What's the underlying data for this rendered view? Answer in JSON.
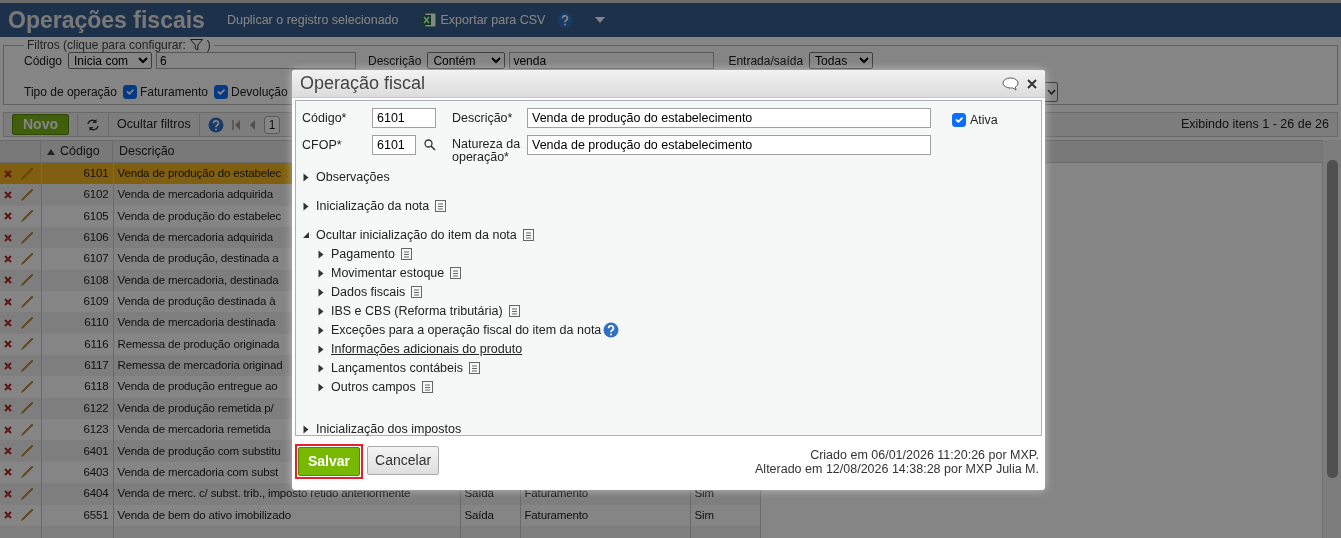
{
  "page": {
    "title": "Operações fiscais",
    "actions": [
      {
        "label": "Duplicar o registro selecionado",
        "kind": "plain"
      },
      {
        "label": "Exportar para CSV",
        "kind": "csv"
      }
    ]
  },
  "filters": {
    "legend_start": "Filtros (clique para configurar:",
    "legend_end": ")",
    "fields": [
      {
        "label": "Código",
        "operator": "Inicia com",
        "value": "6"
      },
      {
        "label": "Descrição",
        "operator": "Contém",
        "value": "venda"
      },
      {
        "label": "Entrada/saída",
        "operator": "Todas"
      }
    ],
    "operation_types": {
      "label": "Tipo de operação",
      "options": [
        {
          "label": "Faturamento",
          "checked": true
        },
        {
          "label": "Devolução",
          "checked": true
        }
      ]
    }
  },
  "toolbar": {
    "new_button": "Novo",
    "hide_filters": "Ocultar filtros",
    "page": "1",
    "summary": "Exibindo itens 1 - 26 de 26"
  },
  "table": {
    "columns": [
      {
        "label": "Código",
        "sorted": true
      },
      {
        "label": "Descrição",
        "sorted": false
      }
    ],
    "rows": [
      {
        "code": "6101",
        "description": "Venda de produção do estabelec",
        "selected": true
      },
      {
        "code": "6102",
        "description": "Venda de mercadoria adquirida",
        "selected": false
      },
      {
        "code": "6105",
        "description": "Venda de produção do estabelec",
        "selected": false
      },
      {
        "code": "6106",
        "description": "Venda de mercadoria adquirida",
        "selected": false
      },
      {
        "code": "6107",
        "description": "Venda de produção, destinada a",
        "selected": false
      },
      {
        "code": "6108",
        "description": "Venda de mercadoria, destinada",
        "selected": false
      },
      {
        "code": "6109",
        "description": "Venda de produção destinada à",
        "selected": false
      },
      {
        "code": "6110",
        "description": "Venda de mercadoria destinada",
        "selected": false
      },
      {
        "code": "6116",
        "description": "Remessa de produção originada",
        "selected": false
      },
      {
        "code": "6117",
        "description": "Remessa de mercadoria originad",
        "selected": false
      },
      {
        "code": "6118",
        "description": "Venda de produção entregue ao",
        "selected": false
      },
      {
        "code": "6122",
        "description": "Venda de produção remetida p/",
        "selected": false
      },
      {
        "code": "6123",
        "description": "Venda de mercadoria remetida",
        "selected": false
      },
      {
        "code": "6401",
        "description": "Venda de produção com substitu",
        "selected": false
      },
      {
        "code": "6403",
        "description": "Venda de mercadoria com subst",
        "selected": false
      },
      {
        "code": "6404",
        "description": "Venda de merc. c/ subst. trib., imposto retido anteriormente",
        "direction": "Saída",
        "type": "Faturamento",
        "active": "Sim",
        "selected": false
      },
      {
        "code": "6551",
        "description": "Venda de bem do ativo imobilizado",
        "direction": "Saída",
        "type": "Faturamento",
        "active": "Sim",
        "selected": false
      }
    ]
  },
  "dialog": {
    "title": "Operação fiscal",
    "fields": [
      {
        "label": "Código*",
        "value": "6101"
      },
      {
        "label": "Descrição*",
        "value": "Venda de produção do estabelecimento"
      },
      {
        "label": "CFOP*",
        "value": "6101"
      },
      {
        "label": "Natureza da operação*",
        "value": "Venda de produção do estabelecimento"
      }
    ],
    "active": {
      "label": "Ativa",
      "checked": true
    },
    "sections": [
      {
        "label": "Observações",
        "kind": "plain",
        "expanded": false
      },
      {
        "label": "Inicialização da nota",
        "kind": "note",
        "expanded": false
      },
      {
        "label": "Ocultar inicialização do item da nota",
        "kind": "note",
        "expanded": true,
        "children": [
          {
            "label": "Pagamento",
            "kind": "note",
            "expanded": false
          },
          {
            "label": "Movimentar estoque",
            "kind": "note",
            "expanded": false
          },
          {
            "label": "Dados fiscais",
            "kind": "note",
            "expanded": false
          },
          {
            "label": "IBS e CBS (Reforma tributária)",
            "kind": "note",
            "expanded": false
          },
          {
            "label": "Exceções para a operação fiscal do item da nota",
            "kind": "help",
            "expanded": false
          },
          {
            "label": "Informações adicionais do produto",
            "kind": "link",
            "expanded": false
          },
          {
            "label": "Lançamentos contábeis",
            "kind": "note",
            "expanded": false
          },
          {
            "label": "Outros campos",
            "kind": "note",
            "expanded": false
          }
        ]
      },
      {
        "label": "Inicialização dos impostos",
        "kind": "plain",
        "expanded": false
      }
    ],
    "buttons": [
      {
        "label": "Salvar",
        "kind": "primary",
        "highlighted": true
      },
      {
        "label": "Cancelar",
        "kind": "secondary",
        "highlighted": false
      }
    ],
    "audit": [
      "Criado em 06/01/2026 11:20:26 por MXP.",
      "Alterado em 12/08/2026 14:38:28 por MXP Julia M."
    ]
  }
}
